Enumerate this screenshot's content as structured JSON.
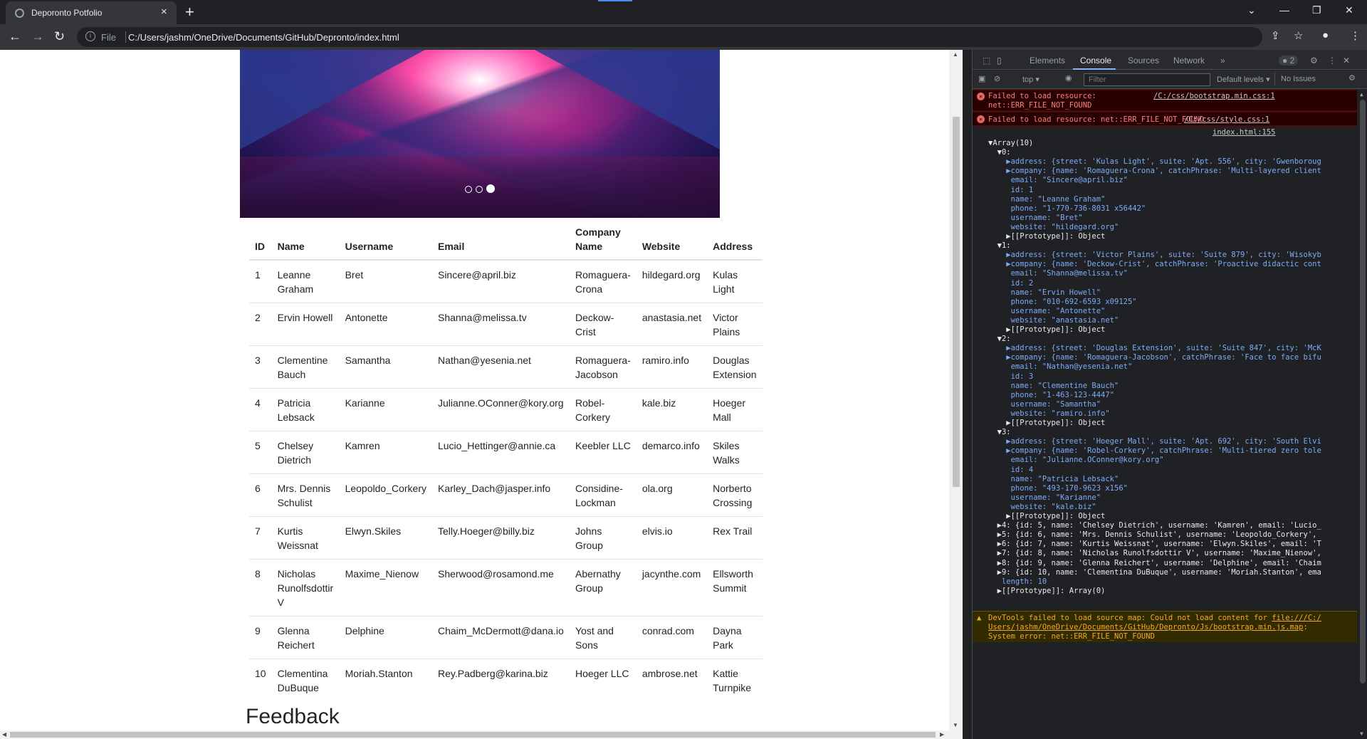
{
  "browser": {
    "tab_title": "Deporonto Potfolio",
    "tab_close": "×",
    "new_tab": "+",
    "scheme_label": "File",
    "url": "C:/Users/jashm/OneDrive/Documents/GitHub/Depronto/index.html",
    "window_controls": [
      "⌄",
      "—",
      "❐",
      "✕"
    ]
  },
  "carousel": {
    "indicator_count": 3,
    "active_index": 2
  },
  "table": {
    "headers": [
      "ID",
      "Name",
      "Username",
      "Email",
      "Company Name",
      "Website",
      "Address"
    ],
    "rows": [
      [
        "1",
        "Leanne Graham",
        "Bret",
        "Sincere@april.biz",
        "Romaguera-Crona",
        "hildegard.org",
        "Kulas Light"
      ],
      [
        "2",
        "Ervin Howell",
        "Antonette",
        "Shanna@melissa.tv",
        "Deckow-Crist",
        "anastasia.net",
        "Victor Plains"
      ],
      [
        "3",
        "Clementine Bauch",
        "Samantha",
        "Nathan@yesenia.net",
        "Romaguera-Jacobson",
        "ramiro.info",
        "Douglas Extension"
      ],
      [
        "4",
        "Patricia Lebsack",
        "Karianne",
        "Julianne.OConner@kory.org",
        "Robel-Corkery",
        "kale.biz",
        "Hoeger Mall"
      ],
      [
        "5",
        "Chelsey Dietrich",
        "Kamren",
        "Lucio_Hettinger@annie.ca",
        "Keebler LLC",
        "demarco.info",
        "Skiles Walks"
      ],
      [
        "6",
        "Mrs. Dennis Schulist",
        "Leopoldo_Corkery",
        "Karley_Dach@jasper.info",
        "Considine-Lockman",
        "ola.org",
        "Norberto Crossing"
      ],
      [
        "7",
        "Kurtis Weissnat",
        "Elwyn.Skiles",
        "Telly.Hoeger@billy.biz",
        "Johns Group",
        "elvis.io",
        "Rex Trail"
      ],
      [
        "8",
        "Nicholas Runolfsdottir V",
        "Maxime_Nienow",
        "Sherwood@rosamond.me",
        "Abernathy Group",
        "jacynthe.com",
        "Ellsworth Summit"
      ],
      [
        "9",
        "Glenna Reichert",
        "Delphine",
        "Chaim_McDermott@dana.io",
        "Yost and Sons",
        "conrad.com",
        "Dayna Park"
      ],
      [
        "10",
        "Clementina DuBuque",
        "Moriah.Stanton",
        "Rey.Padberg@karina.biz",
        "Hoeger LLC",
        "ambrose.net",
        "Kattie Turnpike"
      ]
    ]
  },
  "feedback_heading": "Feedback",
  "devtools": {
    "tabs": [
      "Elements",
      "Console",
      "Sources",
      "Network"
    ],
    "active_tab": "Console",
    "more_tabs": "»",
    "issue_badge": "2",
    "context": "top",
    "filter_placeholder": "Filter",
    "levels": "Default levels",
    "issues": "No Issues",
    "errors": [
      {
        "msg1": "Failed to load resource:",
        "msg2": "net::ERR_FILE_NOT_FOUND",
        "source": "/C:/css/bootstrap.min.css:1"
      },
      {
        "msg1": "Failed to load resource: net::ERR_FILE_NOT_FOUND",
        "msg2": "",
        "source": "/C:/css/style.css:1"
      }
    ],
    "log_source": "index.html:155",
    "console_lines": [
      "▼Array(10)",
      "  ▼0:",
      "    ▶address: {street: 'Kulas Light', suite: 'Apt. 556', city: 'Gwenboroug",
      "    ▶company: {name: 'Romaguera-Crona', catchPhrase: 'Multi-layered client",
      "     email: \"Sincere@april.biz\"",
      "     id: 1",
      "     name: \"Leanne Graham\"",
      "     phone: \"1-770-736-8031 x56442\"",
      "     username: \"Bret\"",
      "     website: \"hildegard.org\"",
      "    ▶[[Prototype]]: Object",
      "  ▼1:",
      "    ▶address: {street: 'Victor Plains', suite: 'Suite 879', city: 'Wisokyb",
      "    ▶company: {name: 'Deckow-Crist', catchPhrase: 'Proactive didactic cont",
      "     email: \"Shanna@melissa.tv\"",
      "     id: 2",
      "     name: \"Ervin Howell\"",
      "     phone: \"010-692-6593 x09125\"",
      "     username: \"Antonette\"",
      "     website: \"anastasia.net\"",
      "    ▶[[Prototype]]: Object",
      "  ▼2:",
      "    ▶address: {street: 'Douglas Extension', suite: 'Suite 847', city: 'McK",
      "    ▶company: {name: 'Romaguera-Jacobson', catchPhrase: 'Face to face bifu",
      "     email: \"Nathan@yesenia.net\"",
      "     id: 3",
      "     name: \"Clementine Bauch\"",
      "     phone: \"1-463-123-4447\"",
      "     username: \"Samantha\"",
      "     website: \"ramiro.info\"",
      "    ▶[[Prototype]]: Object",
      "  ▼3:",
      "    ▶address: {street: 'Hoeger Mall', suite: 'Apt. 692', city: 'South Elvi",
      "    ▶company: {name: 'Robel-Corkery', catchPhrase: 'Multi-tiered zero tole",
      "     email: \"Julianne.OConner@kory.org\"",
      "     id: 4",
      "     name: \"Patricia Lebsack\"",
      "     phone: \"493-170-9623 x156\"",
      "     username: \"Karianne\"",
      "     website: \"kale.biz\"",
      "    ▶[[Prototype]]: Object",
      "  ▶4: {id: 5, name: 'Chelsey Dietrich', username: 'Kamren', email: 'Lucio_",
      "  ▶5: {id: 6, name: 'Mrs. Dennis Schulist', username: 'Leopoldo_Corkery',",
      "  ▶6: {id: 7, name: 'Kurtis Weissnat', username: 'Elwyn.Skiles', email: 'T",
      "  ▶7: {id: 8, name: 'Nicholas Runolfsdottir V', username: 'Maxime_Nienow',",
      "  ▶8: {id: 9, name: 'Glenna Reichert', username: 'Delphine', email: 'Chaim",
      "  ▶9: {id: 10, name: 'Clementina DuBuque', username: 'Moriah.Stanton', ema",
      "   length: 10",
      "  ▶[[Prototype]]: Array(0)"
    ],
    "warning": {
      "prefix": "DevTools failed to load source map: Could not load content for ",
      "link1": "file:///C:/",
      "link2": "Users/jashm/OneDrive/Documents/GitHub/Depronto/Js/bootstrap.min.js.map",
      "suffix": ":",
      "line3": "System error: net::ERR_FILE_NOT_FOUND"
    }
  }
}
